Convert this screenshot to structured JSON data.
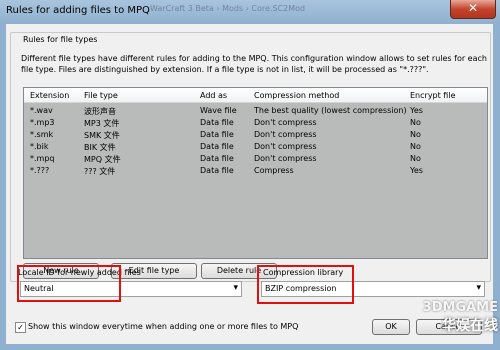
{
  "window": {
    "title": "Rules for adding files to MPQ",
    "background_crumb": "WarCraft 3 Beta › Mods › Core.SC2Mod",
    "close_icon": "close-icon"
  },
  "group": {
    "title": "Rules for file types",
    "description": "Different file types have different rules for adding to the MPQ. This configuration window allows to set rules for each file type. Files are distinguished by extension. If a file type is not in list, it will be processed as \"*.???\"."
  },
  "table": {
    "headers": [
      "Extension",
      "File type",
      "Add as",
      "Compression method",
      "Encrypt file"
    ],
    "rows": [
      [
        "*.wav",
        "波形声音",
        "Wave file",
        "The best quality (lowest compression)",
        "Yes"
      ],
      [
        "*.mp3",
        "MP3 文件",
        "Data file",
        "Don't compress",
        "No"
      ],
      [
        "*.smk",
        "SMK 文件",
        "Data file",
        "Don't compress",
        "No"
      ],
      [
        "*.bik",
        "BIK 文件",
        "Data file",
        "Don't compress",
        "No"
      ],
      [
        "*.mpq",
        "MPQ 文件",
        "Data file",
        "Don't compress",
        "No"
      ],
      [
        "*.???",
        "??? 文件",
        "Data file",
        "Compress",
        "Yes"
      ]
    ]
  },
  "buttons": {
    "new_rule": "New rule",
    "edit_file_type": "Edit file type",
    "delete_rule": "Delete rule",
    "ok": "OK",
    "cancel": "Cancel"
  },
  "locale": {
    "label": "Locale ID for newly added files",
    "value": "Neutral"
  },
  "compression": {
    "label": "Compression library",
    "value": "BZIP compression"
  },
  "show_window": {
    "label": "Show this window everytime when adding one or more files to MPQ",
    "checked": true,
    "mark": "✓"
  },
  "watermark": {
    "line1": "3DMGAME",
    "line2": "华娱在线"
  },
  "colors": {
    "highlight": "#e01010",
    "list_bg": "#b9bbba"
  }
}
